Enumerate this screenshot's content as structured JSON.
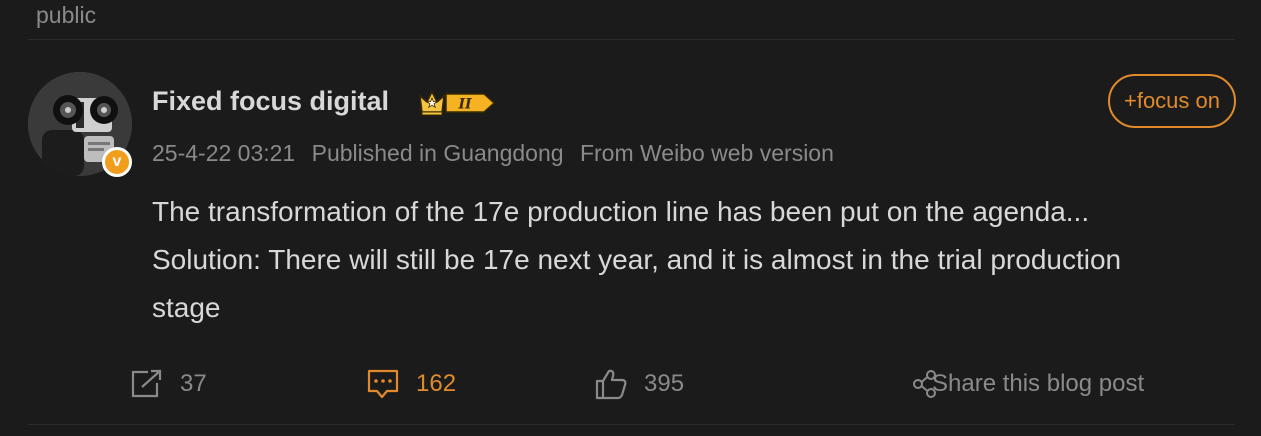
{
  "top_label": "public",
  "author": {
    "name": "Fixed focus digital",
    "level_badge": "II",
    "verified_mark": "v"
  },
  "follow_label": "+focus on",
  "meta": {
    "timestamp": "25-4-22 03:21",
    "location": "Published in Guangdong",
    "source": "From Weibo web version"
  },
  "post": {
    "line1": "The transformation of the 17e production line has been put on the agenda...",
    "line2": "Solution: There will still be 17e next year, and it is almost in the trial production",
    "line3": "stage"
  },
  "actions": {
    "forward_count": "37",
    "comment_count": "162",
    "like_count": "395",
    "share_label": "Share this blog post"
  },
  "icons": {
    "forward": "forward-icon",
    "comment": "comment-icon",
    "like": "like-icon",
    "share": "share-icon",
    "crown": "crown-icon",
    "verified": "verified-icon"
  },
  "colors": {
    "background": "#1b1b1b",
    "text": "#d8d8d8",
    "muted": "#8a8a8a",
    "accent": "#e08a2c",
    "badge": "#f29e1d"
  }
}
